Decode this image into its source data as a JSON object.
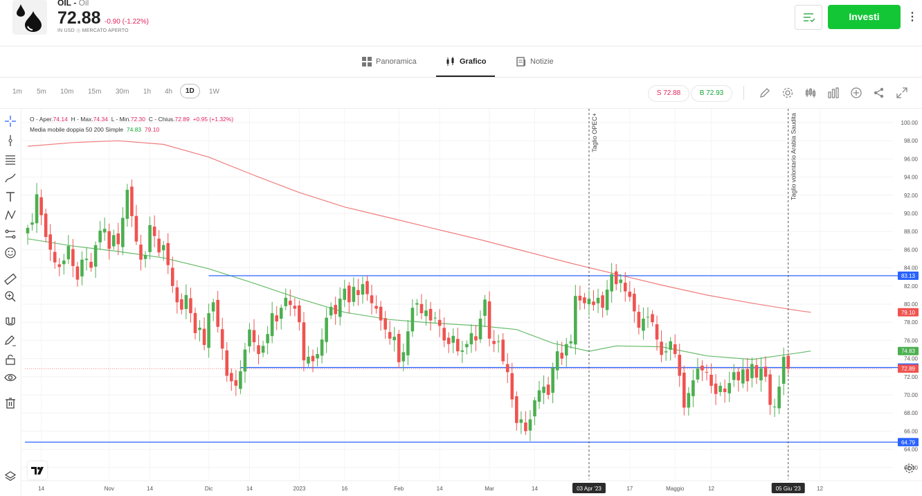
{
  "instrument": {
    "symbol": "OIL",
    "name": "Oil",
    "price": "72.88",
    "change": "-0.90 (-1.22%)",
    "currency_label": "IN USD",
    "market_status": "MERCATO APERTO"
  },
  "header": {
    "invest_label": "Investi"
  },
  "tabs": [
    {
      "label": "Panoramica"
    },
    {
      "label": "Grafico"
    },
    {
      "label": "Notizie"
    }
  ],
  "timeframes": [
    "1m",
    "5m",
    "10m",
    "15m",
    "30m",
    "1h",
    "4h",
    "1D",
    "1W"
  ],
  "active_timeframe": "1D",
  "quotes": {
    "sell": "S 72.88",
    "buy": "B 72.93"
  },
  "legend": {
    "ohlc_prefix_o": "O - Aper.",
    "o": "74.14",
    "h_prefix": "H - Max.",
    "h": "74.34",
    "l_prefix": "L - Min.",
    "l": "72.30",
    "c_prefix": "C - Chius.",
    "c": "72.89",
    "chg": "+0.95 (+1.32%)",
    "ma_label": "Media mobile doppia 50 200 Simple",
    "ma50": "74.83",
    "ma200": "79.10"
  },
  "colors": {
    "up": "#26a69a",
    "up_main": "#4caf50",
    "down": "#ef5350",
    "ma50": "#66bb6a",
    "ma200": "#ef7b7b",
    "level": "#2962ff",
    "accent": "#13c636"
  },
  "chart_data": {
    "type": "candlestick",
    "y_range": [
      61,
      101
    ],
    "y_ticks": [
      "100.00",
      "98.00",
      "96.00",
      "94.00",
      "92.00",
      "90.00",
      "88.00",
      "86.00",
      "84.00",
      "82.00",
      "80.00",
      "78.00",
      "76.00",
      "74.00",
      "72.00",
      "70.00",
      "68.00",
      "66.00",
      "64.00",
      "62.00"
    ],
    "x_labels": [
      {
        "label": "14",
        "i": 3
      },
      {
        "label": "Nov",
        "i": 18
      },
      {
        "label": "14",
        "i": 27
      },
      {
        "label": "Dic",
        "i": 40
      },
      {
        "label": "14",
        "i": 49
      },
      {
        "label": "2023",
        "i": 60
      },
      {
        "label": "16",
        "i": 70
      },
      {
        "label": "Feb",
        "i": 82
      },
      {
        "label": "14",
        "i": 91
      },
      {
        "label": "Mar",
        "i": 102
      },
      {
        "label": "14",
        "i": 112
      },
      {
        "label": "03 Apr '23",
        "i": 124,
        "highlight": true
      },
      {
        "label": "17",
        "i": 133
      },
      {
        "label": "Maggio",
        "i": 143
      },
      {
        "label": "12",
        "i": 151
      },
      {
        "label": "05 Giu '23",
        "i": 168,
        "highlight": true
      },
      {
        "label": "12",
        "i": 175
      }
    ],
    "levels": [
      {
        "value": 83.13,
        "label": "83.13",
        "start_i": 40
      },
      {
        "value": 73.01,
        "label": "73.01",
        "start_i": 47
      },
      {
        "value": 64.79,
        "label": "64.79",
        "start_i": 0
      }
    ],
    "price_labels": [
      {
        "value": 79.1,
        "label": "79.10",
        "color": "#ef5350"
      },
      {
        "value": 74.83,
        "label": "74.83",
        "color": "#4caf50"
      },
      {
        "value": 72.89,
        "label": "72.89",
        "color": "#ef5350"
      }
    ],
    "events": [
      {
        "label": "Taglio OPEC+",
        "i": 124
      },
      {
        "label": "Taglio volontario Arabia Saudita",
        "i": 168
      }
    ],
    "closes": [
      88.4,
      89.0,
      92.1,
      89.8,
      87.4,
      86.0,
      84.6,
      84.1,
      84.8,
      86.4,
      84.2,
      82.7,
      84.9,
      85.0,
      84.0,
      86.5,
      88.1,
      88.3,
      86.1,
      87.6,
      86.6,
      89.5,
      92.6,
      89.7,
      86.9,
      84.9,
      85.4,
      88.7,
      87.5,
      85.7,
      86.5,
      84.3,
      82.0,
      80.2,
      79.4,
      81.0,
      79.0,
      76.8,
      77.4,
      75.5,
      79.0,
      80.2,
      77.5,
      75.1,
      72.1,
      71.5,
      71.0,
      72.6,
      75.0,
      77.2,
      75.8,
      74.5,
      75.4,
      76.7,
      79.0,
      78.1,
      79.6,
      80.7,
      79.9,
      79.5,
      78.0,
      73.8,
      74.2,
      73.7,
      74.5,
      76.1,
      78.5,
      79.7,
      78.9,
      80.6,
      81.7,
      80.2,
      81.9,
      81.0,
      82.2,
      81.1,
      80.1,
      79.5,
      78.2,
      77.2,
      76.2,
      76.4,
      73.6,
      74.7,
      77.0,
      79.6,
      80.1,
      79.0,
      79.3,
      78.2,
      78.5,
      77.6,
      76.0,
      75.6,
      76.5,
      74.8,
      74.9,
      75.6,
      76.8,
      76.0,
      78.4,
      80.5,
      76.2,
      75.6,
      75.9,
      73.7,
      72.5,
      69.5,
      66.9,
      67.3,
      66.0,
      67.3,
      69.4,
      70.5,
      70.9,
      70.0,
      73.0,
      74.8,
      74.0,
      75.6,
      75.9,
      80.9,
      80.4,
      80.1,
      80.6,
      79.9,
      80.7,
      79.6,
      81.6,
      83.3,
      82.2,
      82.7,
      81.4,
      80.8,
      79.2,
      77.4,
      78.4,
      78.6,
      78.0,
      76.1,
      74.4,
      74.8,
      75.9,
      74.5,
      72.1,
      68.6,
      70.2,
      71.6,
      72.9,
      72.7,
      72.5,
      71.0,
      70.1,
      71.0,
      70.3,
      71.3,
      72.5,
      71.6,
      72.8,
      71.5,
      73.4,
      71.9,
      72.9,
      72.0,
      68.9,
      68.7,
      70.9,
      74.2,
      72.9
    ],
    "ma50": [
      [
        0,
        87.2
      ],
      [
        10,
        86.4
      ],
      [
        20,
        85.8
      ],
      [
        30,
        85.1
      ],
      [
        40,
        83.9
      ],
      [
        50,
        82.3
      ],
      [
        60,
        80.6
      ],
      [
        70,
        79.1
      ],
      [
        80,
        78.3
      ],
      [
        90,
        77.9
      ],
      [
        100,
        77.6
      ],
      [
        108,
        77.2
      ],
      [
        116,
        75.7
      ],
      [
        124,
        74.8
      ],
      [
        130,
        75.4
      ],
      [
        140,
        75.3
      ],
      [
        150,
        74.3
      ],
      [
        160,
        73.9
      ],
      [
        170,
        74.6
      ],
      [
        173,
        74.83
      ]
    ],
    "ma200": [
      [
        0,
        97.4
      ],
      [
        10,
        97.8
      ],
      [
        20,
        98.0
      ],
      [
        30,
        97.6
      ],
      [
        40,
        96.2
      ],
      [
        50,
        94.2
      ],
      [
        60,
        92.3
      ],
      [
        70,
        90.7
      ],
      [
        80,
        89.5
      ],
      [
        90,
        88.3
      ],
      [
        100,
        87.1
      ],
      [
        110,
        85.8
      ],
      [
        120,
        84.5
      ],
      [
        130,
        83.3
      ],
      [
        140,
        82.1
      ],
      [
        150,
        81.0
      ],
      [
        160,
        80.1
      ],
      [
        170,
        79.3
      ],
      [
        173,
        79.1
      ]
    ]
  }
}
